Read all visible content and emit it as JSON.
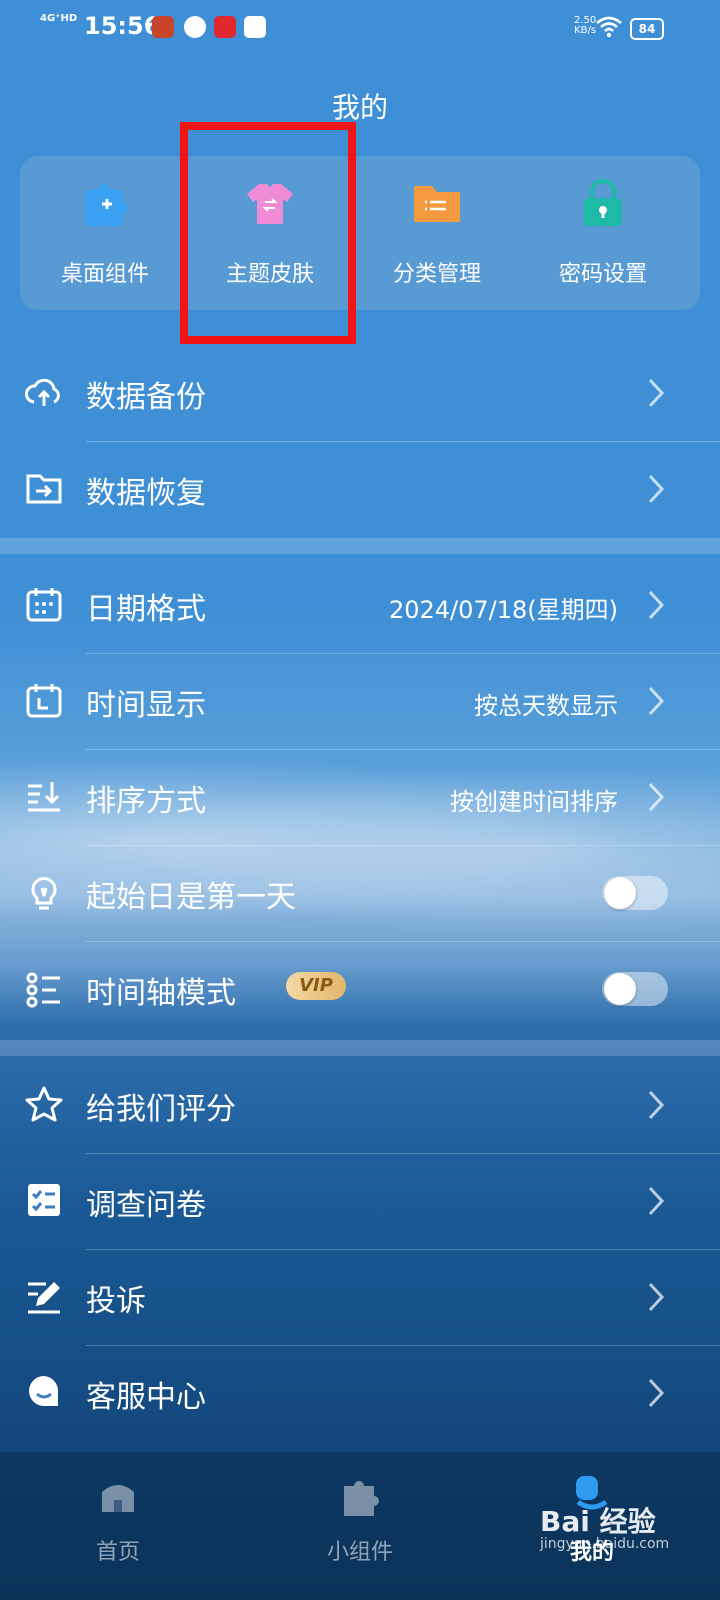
{
  "status_bar": {
    "network": "4G⁺HD",
    "time": "15:56",
    "speed_value": "2.50",
    "speed_unit": "KB/s",
    "battery": "84"
  },
  "header": {
    "title": "我的"
  },
  "quick_actions": [
    {
      "label": "桌面组件",
      "icon": "puzzle-icon"
    },
    {
      "label": "主题皮肤",
      "icon": "tshirt-icon"
    },
    {
      "label": "分类管理",
      "icon": "folder-icon"
    },
    {
      "label": "密码设置",
      "icon": "lock-icon"
    }
  ],
  "group1": [
    {
      "label": "数据备份",
      "icon": "cloud-upload-icon"
    },
    {
      "label": "数据恢复",
      "icon": "folder-import-icon"
    }
  ],
  "group2": [
    {
      "label": "日期格式",
      "value": "2024/07/18(星期四)",
      "icon": "calendar-icon"
    },
    {
      "label": "时间显示",
      "value": "按总天数显示",
      "icon": "calendar-clock-icon"
    },
    {
      "label": "排序方式",
      "value": "按创建时间排序",
      "icon": "sort-icon"
    },
    {
      "label": "起始日是第一天",
      "icon": "bulb-icon",
      "toggle_on": false
    },
    {
      "label": "时间轴模式",
      "badge": "VIP",
      "icon": "timeline-icon",
      "toggle_on": false
    }
  ],
  "group3": [
    {
      "label": "给我们评分",
      "icon": "star-icon"
    },
    {
      "label": "调查问卷",
      "icon": "checklist-icon"
    },
    {
      "label": "投诉",
      "icon": "edit-icon"
    },
    {
      "label": "客服中心",
      "icon": "support-icon"
    }
  ],
  "tab_bar": [
    {
      "label": "首页",
      "icon": "home-icon"
    },
    {
      "label": "小组件",
      "icon": "puzzle-icon"
    },
    {
      "label": "我的",
      "icon": "profile-icon",
      "active": true
    }
  ],
  "watermark": {
    "main": "Bai 经验",
    "sub": "jingyan.baidu.com"
  },
  "colors": {
    "highlight_box": "#f01414",
    "vip_badge": "#e2b66a"
  }
}
